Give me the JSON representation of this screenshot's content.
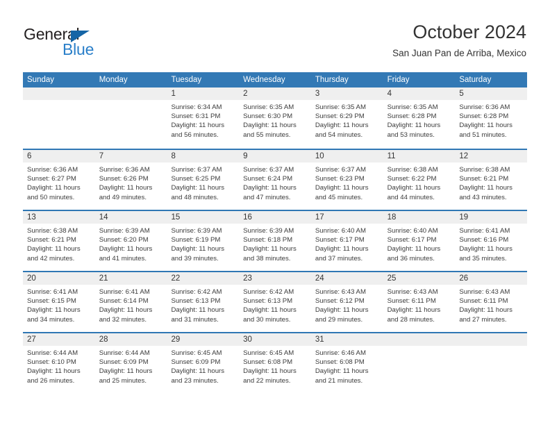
{
  "brand": {
    "name_top": "General",
    "name_bottom": "Blue",
    "color_dark": "#231f20",
    "color_blue": "#2a7fc9",
    "triangle_color": "#1565a6"
  },
  "header": {
    "title": "October 2024",
    "subtitle": "San Juan Pan de Arriba, Mexico"
  },
  "theme": {
    "header_bg": "#3379b5",
    "row_divider": "#2f77b4",
    "day_strip_bg": "#efefef",
    "text": "#333333"
  },
  "weekdays": [
    "Sunday",
    "Monday",
    "Tuesday",
    "Wednesday",
    "Thursday",
    "Friday",
    "Saturday"
  ],
  "labels": {
    "sunrise_prefix": "Sunrise:",
    "sunset_prefix": "Sunset:",
    "daylight_prefix": "Daylight:"
  },
  "weeks": [
    [
      {
        "day": "",
        "sunrise": "",
        "sunset": "",
        "daylight": ""
      },
      {
        "day": "",
        "sunrise": "",
        "sunset": "",
        "daylight": ""
      },
      {
        "day": "1",
        "sunrise": "Sunrise: 6:34 AM",
        "sunset": "Sunset: 6:31 PM",
        "daylight": "Daylight: 11 hours and 56 minutes."
      },
      {
        "day": "2",
        "sunrise": "Sunrise: 6:35 AM",
        "sunset": "Sunset: 6:30 PM",
        "daylight": "Daylight: 11 hours and 55 minutes."
      },
      {
        "day": "3",
        "sunrise": "Sunrise: 6:35 AM",
        "sunset": "Sunset: 6:29 PM",
        "daylight": "Daylight: 11 hours and 54 minutes."
      },
      {
        "day": "4",
        "sunrise": "Sunrise: 6:35 AM",
        "sunset": "Sunset: 6:28 PM",
        "daylight": "Daylight: 11 hours and 53 minutes."
      },
      {
        "day": "5",
        "sunrise": "Sunrise: 6:36 AM",
        "sunset": "Sunset: 6:28 PM",
        "daylight": "Daylight: 11 hours and 51 minutes."
      }
    ],
    [
      {
        "day": "6",
        "sunrise": "Sunrise: 6:36 AM",
        "sunset": "Sunset: 6:27 PM",
        "daylight": "Daylight: 11 hours and 50 minutes."
      },
      {
        "day": "7",
        "sunrise": "Sunrise: 6:36 AM",
        "sunset": "Sunset: 6:26 PM",
        "daylight": "Daylight: 11 hours and 49 minutes."
      },
      {
        "day": "8",
        "sunrise": "Sunrise: 6:37 AM",
        "sunset": "Sunset: 6:25 PM",
        "daylight": "Daylight: 11 hours and 48 minutes."
      },
      {
        "day": "9",
        "sunrise": "Sunrise: 6:37 AM",
        "sunset": "Sunset: 6:24 PM",
        "daylight": "Daylight: 11 hours and 47 minutes."
      },
      {
        "day": "10",
        "sunrise": "Sunrise: 6:37 AM",
        "sunset": "Sunset: 6:23 PM",
        "daylight": "Daylight: 11 hours and 45 minutes."
      },
      {
        "day": "11",
        "sunrise": "Sunrise: 6:38 AM",
        "sunset": "Sunset: 6:22 PM",
        "daylight": "Daylight: 11 hours and 44 minutes."
      },
      {
        "day": "12",
        "sunrise": "Sunrise: 6:38 AM",
        "sunset": "Sunset: 6:21 PM",
        "daylight": "Daylight: 11 hours and 43 minutes."
      }
    ],
    [
      {
        "day": "13",
        "sunrise": "Sunrise: 6:38 AM",
        "sunset": "Sunset: 6:21 PM",
        "daylight": "Daylight: 11 hours and 42 minutes."
      },
      {
        "day": "14",
        "sunrise": "Sunrise: 6:39 AM",
        "sunset": "Sunset: 6:20 PM",
        "daylight": "Daylight: 11 hours and 41 minutes."
      },
      {
        "day": "15",
        "sunrise": "Sunrise: 6:39 AM",
        "sunset": "Sunset: 6:19 PM",
        "daylight": "Daylight: 11 hours and 39 minutes."
      },
      {
        "day": "16",
        "sunrise": "Sunrise: 6:39 AM",
        "sunset": "Sunset: 6:18 PM",
        "daylight": "Daylight: 11 hours and 38 minutes."
      },
      {
        "day": "17",
        "sunrise": "Sunrise: 6:40 AM",
        "sunset": "Sunset: 6:17 PM",
        "daylight": "Daylight: 11 hours and 37 minutes."
      },
      {
        "day": "18",
        "sunrise": "Sunrise: 6:40 AM",
        "sunset": "Sunset: 6:17 PM",
        "daylight": "Daylight: 11 hours and 36 minutes."
      },
      {
        "day": "19",
        "sunrise": "Sunrise: 6:41 AM",
        "sunset": "Sunset: 6:16 PM",
        "daylight": "Daylight: 11 hours and 35 minutes."
      }
    ],
    [
      {
        "day": "20",
        "sunrise": "Sunrise: 6:41 AM",
        "sunset": "Sunset: 6:15 PM",
        "daylight": "Daylight: 11 hours and 34 minutes."
      },
      {
        "day": "21",
        "sunrise": "Sunrise: 6:41 AM",
        "sunset": "Sunset: 6:14 PM",
        "daylight": "Daylight: 11 hours and 32 minutes."
      },
      {
        "day": "22",
        "sunrise": "Sunrise: 6:42 AM",
        "sunset": "Sunset: 6:13 PM",
        "daylight": "Daylight: 11 hours and 31 minutes."
      },
      {
        "day": "23",
        "sunrise": "Sunrise: 6:42 AM",
        "sunset": "Sunset: 6:13 PM",
        "daylight": "Daylight: 11 hours and 30 minutes."
      },
      {
        "day": "24",
        "sunrise": "Sunrise: 6:43 AM",
        "sunset": "Sunset: 6:12 PM",
        "daylight": "Daylight: 11 hours and 29 minutes."
      },
      {
        "day": "25",
        "sunrise": "Sunrise: 6:43 AM",
        "sunset": "Sunset: 6:11 PM",
        "daylight": "Daylight: 11 hours and 28 minutes."
      },
      {
        "day": "26",
        "sunrise": "Sunrise: 6:43 AM",
        "sunset": "Sunset: 6:11 PM",
        "daylight": "Daylight: 11 hours and 27 minutes."
      }
    ],
    [
      {
        "day": "27",
        "sunrise": "Sunrise: 6:44 AM",
        "sunset": "Sunset: 6:10 PM",
        "daylight": "Daylight: 11 hours and 26 minutes."
      },
      {
        "day": "28",
        "sunrise": "Sunrise: 6:44 AM",
        "sunset": "Sunset: 6:09 PM",
        "daylight": "Daylight: 11 hours and 25 minutes."
      },
      {
        "day": "29",
        "sunrise": "Sunrise: 6:45 AM",
        "sunset": "Sunset: 6:09 PM",
        "daylight": "Daylight: 11 hours and 23 minutes."
      },
      {
        "day": "30",
        "sunrise": "Sunrise: 6:45 AM",
        "sunset": "Sunset: 6:08 PM",
        "daylight": "Daylight: 11 hours and 22 minutes."
      },
      {
        "day": "31",
        "sunrise": "Sunrise: 6:46 AM",
        "sunset": "Sunset: 6:08 PM",
        "daylight": "Daylight: 11 hours and 21 minutes."
      },
      {
        "day": "",
        "sunrise": "",
        "sunset": "",
        "daylight": ""
      },
      {
        "day": "",
        "sunrise": "",
        "sunset": "",
        "daylight": ""
      }
    ]
  ]
}
